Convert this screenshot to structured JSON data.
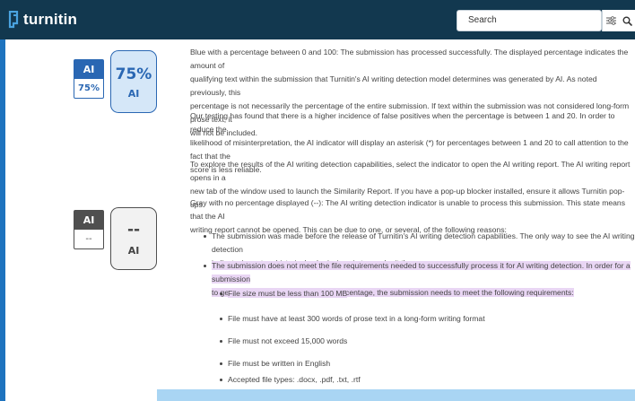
{
  "header": {
    "logo_text": "turnitin",
    "search_placeholder": "Search"
  },
  "colors": {
    "header_bg": "#12384f",
    "accent_blue": "#1e73be",
    "indicator_blue": "#2a67b3",
    "indicator_gray": "#4f4f4f",
    "highlight_purple": "#e9d6f4"
  },
  "blue_section": {
    "small_indicator": {
      "top": "AI",
      "bottom": "75%"
    },
    "big_indicator": {
      "value": "75%",
      "label": "AI"
    },
    "paragraphs": [
      [
        "Blue with a percentage between 0 and 100: The submission has processed successfully. The displayed percentage indicates the amount of",
        "qualifying text within the submission that Turnitin's AI writing detection model determines was generated by AI. As noted previously, this",
        "percentage is not necessarily the percentage of the entire submission. If text within the submission was not considered long-form prose text, it",
        "will not be included."
      ],
      [
        "Our testing has found that there is a higher incidence of false positives when the percentage is between 1 and 20. In order to reduce the",
        "likelihood of misinterpretation, the AI indicator will display an asterisk (*) for percentages between 1 and 20 to call attention to the fact that the",
        "score is less reliable."
      ],
      [
        "To explore the results of the AI writing detection capabilities, select the indicator to open the AI writing report. The AI writing report opens in a",
        "new tab of the window used to launch the Similarity Report. If you have a pop-up blocker installed, ensure it allows Turnitin pop-ups."
      ]
    ]
  },
  "gray_section": {
    "small_indicator": {
      "top": "AI",
      "bottom": "--"
    },
    "big_indicator": {
      "value": "--",
      "label": "AI"
    },
    "intro": [
      "Gray with no percentage displayed (--): The AI writing detection indicator is unable to process this submission. This state means that the AI",
      "writing report cannot be opened. This can be due to one, or several, of the following reasons:"
    ],
    "reason_1": [
      "The submission was made before the release of Turnitin's AI writing detection capabilities. The only way to see the AI writing detection",
      "indicator/report on historical submissions is to resubmit them."
    ],
    "reason_2": [
      "The submission does not meet the file requirements needed to successfully process it for AI writing detection. In order for a submission",
      "to generate an AI writing report and percentage, the submission needs to meet the following requirements:"
    ],
    "requirements": [
      "File size must be less than 100 MB",
      "File must have at least 300 words of prose text in a long-form writing format",
      "File must not exceed 15,000 words",
      "File must be written in English",
      "Accepted file types: .docx, .pdf, .txt, .rtf"
    ]
  }
}
